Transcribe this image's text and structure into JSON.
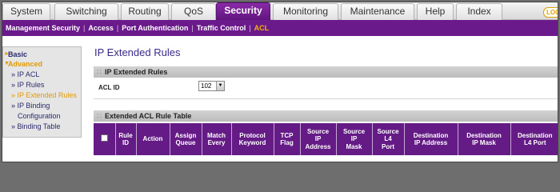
{
  "tabs": [
    {
      "label": "System",
      "active": false
    },
    {
      "label": "Switching",
      "active": false
    },
    {
      "label": "Routing",
      "active": false
    },
    {
      "label": "QoS",
      "active": false
    },
    {
      "label": "Security",
      "active": true
    },
    {
      "label": "Monitoring",
      "active": false
    },
    {
      "label": "Maintenance",
      "active": false
    },
    {
      "label": "Help",
      "active": false
    },
    {
      "label": "Index",
      "active": false
    }
  ],
  "logo_text": "LOG",
  "subnav": [
    "Management Security",
    "Access",
    "Port Authentication",
    "Traffic Control",
    "ACL"
  ],
  "sidebar": {
    "basic": "Basic",
    "advanced": "Advanced",
    "items": [
      "» IP ACL",
      "» IP Rules",
      "» IP Extended Rules",
      "» IP Binding",
      "Configuration",
      "» Binding Table"
    ]
  },
  "page_title": "IP Extended Rules",
  "section1": {
    "title": "IP Extended Rules"
  },
  "acl": {
    "label": "ACL ID",
    "value": "102"
  },
  "section2": {
    "title": "Extended ACL Rule Table"
  },
  "table_headers": [
    [
      "Rule",
      "ID"
    ],
    [
      "Action"
    ],
    [
      "Assign",
      "Queue"
    ],
    [
      "Match",
      "Every"
    ],
    [
      "Protocol",
      "Keyword"
    ],
    [
      "TCP",
      "Flag"
    ],
    [
      "Source",
      "IP",
      "Address"
    ],
    [
      "Source",
      "IP",
      "Mask"
    ],
    [
      "Source",
      "L4",
      "Port"
    ],
    [
      "Destination",
      "IP Address"
    ],
    [
      "Destination",
      "IP Mask"
    ],
    [
      "Destination",
      "L4 Port"
    ]
  ],
  "colors": {
    "accent": "#6a1a8a",
    "highlight": "#e39a00"
  }
}
